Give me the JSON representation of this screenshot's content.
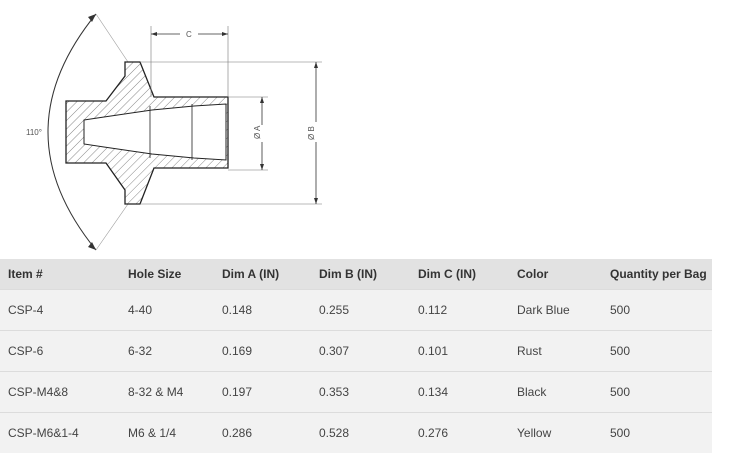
{
  "drawing": {
    "angle_label": "110°",
    "dim_c": "C",
    "dim_a": "Ø A",
    "dim_b": "Ø B"
  },
  "table": {
    "headers": [
      "Item #",
      "Hole Size",
      "Dim A (IN)",
      "Dim B (IN)",
      "Dim C (IN)",
      "Color",
      "Quantity per Bag"
    ],
    "rows": [
      [
        "CSP-4",
        "4-40",
        "0.148",
        "0.255",
        "0.112",
        "Dark Blue",
        "500"
      ],
      [
        "CSP-6",
        "6-32",
        "0.169",
        "0.307",
        "0.101",
        "Rust",
        "500"
      ],
      [
        "CSP-M4&8",
        "8-32 & M4",
        "0.197",
        "0.353",
        "0.134",
        "Black",
        "500"
      ],
      [
        "CSP-M6&1-4",
        "M6 & 1/4",
        "0.286",
        "0.528",
        "0.276",
        "Yellow",
        "500"
      ]
    ]
  }
}
